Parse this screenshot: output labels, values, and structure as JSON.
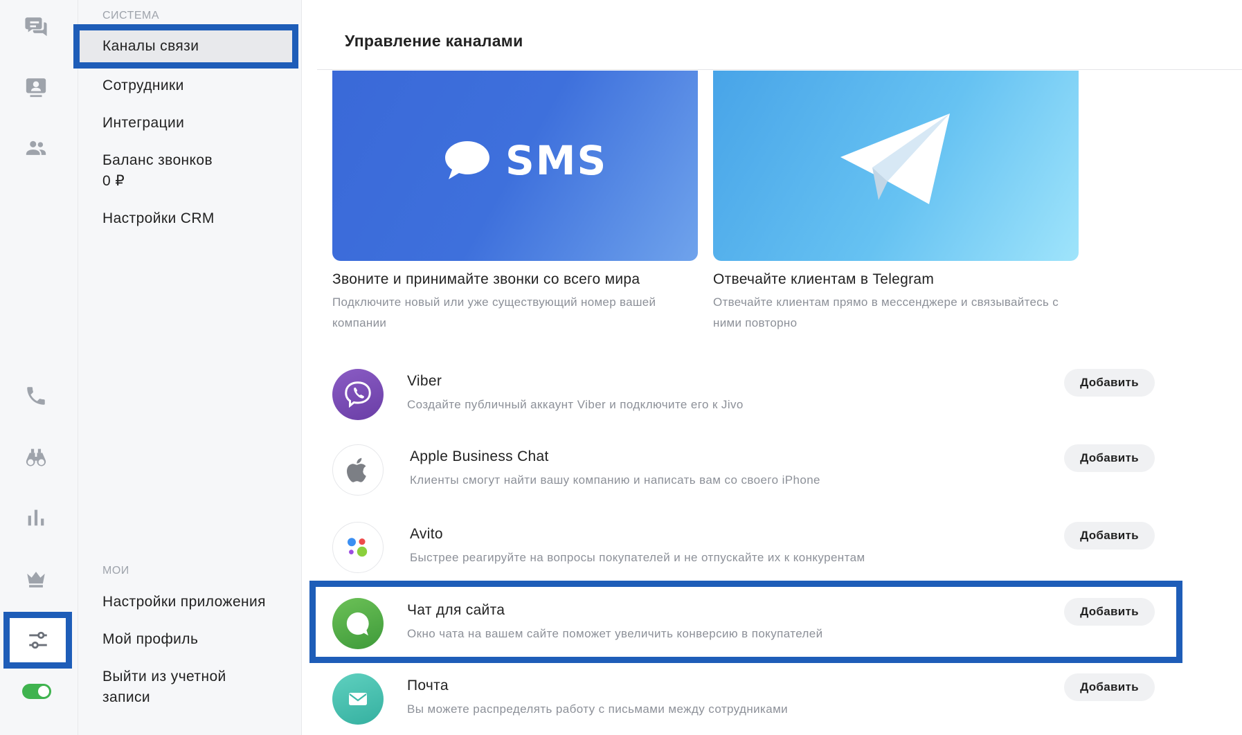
{
  "sidebar_icons": [
    {
      "name": "chat-icon",
      "label": "chats"
    },
    {
      "name": "contact-card-icon",
      "label": "contacts"
    },
    {
      "name": "team-icon",
      "label": "team"
    },
    {
      "name": "phone-icon",
      "label": "calls"
    },
    {
      "name": "binoculars-icon",
      "label": "monitoring"
    },
    {
      "name": "bar-chart-icon",
      "label": "reports"
    },
    {
      "name": "crown-icon",
      "label": "plan"
    },
    {
      "name": "sliders-icon",
      "label": "settings",
      "active": true
    }
  ],
  "status_toggle": {
    "on": true,
    "color": "#3fb34f"
  },
  "nav": {
    "system_section": "Система",
    "system_items": {
      "channels": "Каналы связи",
      "employees": "Сотрудники",
      "integrations": "Интеграции",
      "call_balance": "Баланс звонков",
      "call_balance_value": "0 ₽",
      "crm_settings": "Настройки CRM"
    },
    "my_section": "Мои",
    "my_items": {
      "app_settings": "Настройки приложения",
      "profile": "Мой профиль",
      "logout": "Выйти из учетной записи"
    }
  },
  "main": {
    "title": "Управление каналами",
    "featured": [
      {
        "id": "sms",
        "logo_text": "SMS",
        "title": "Звоните и принимайте звонки со всего мира",
        "description": "Подключите новый или уже существующий номер вашей компании"
      },
      {
        "id": "telegram",
        "title": "Отвечайте клиентам в Telegram",
        "description": "Отвечайте клиентам прямо в мессенджере и связывайтесь с ними повторно"
      }
    ],
    "channels": [
      {
        "title": "Viber",
        "description": "Создайте публичный аккаунт Viber и подключите его к Jivo",
        "button": "Добавить"
      },
      {
        "title": "Apple Business Chat",
        "description": "Клиенты смогут найти вашу компанию и написать вам со своего iPhone",
        "button": "Добавить"
      },
      {
        "title": "Avito",
        "description": "Быстрее реагируйте на вопросы покупателей и не отпускайте их к конкурентам",
        "button": "Добавить"
      },
      {
        "title": "Чат для сайта",
        "description": "Окно чата на вашем сайте поможет увеличить конверсию в покупателей",
        "button": "Добавить"
      },
      {
        "title": "Почта",
        "description": "Вы можете распределять работу с письмами между сотрудниками",
        "button": "Добавить"
      }
    ]
  },
  "colors": {
    "highlight": "#1e5db8",
    "viber": "#7b4db3",
    "chat": "#4fae48",
    "mail": "#4cc3b0",
    "avito_blue": "#3b8ff2",
    "avito_red": "#ee4b4b",
    "avito_purple": "#9c4de0",
    "avito_green": "#8bd03c"
  }
}
